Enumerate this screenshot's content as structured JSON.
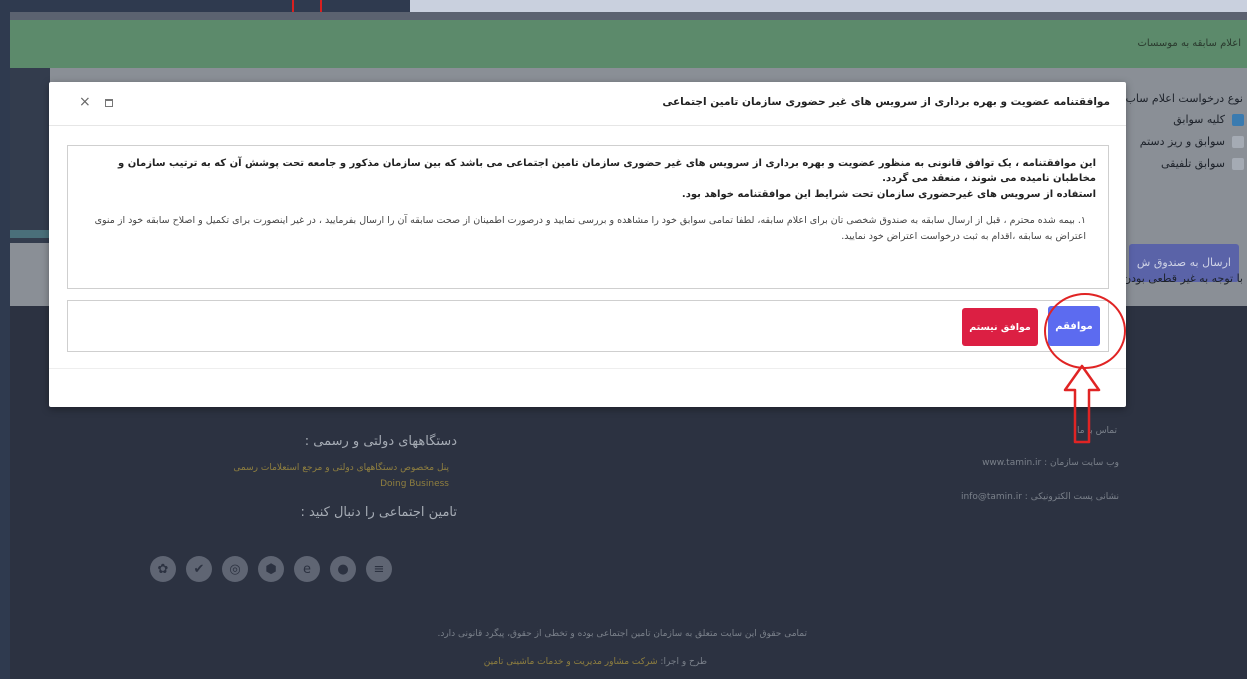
{
  "colors": {
    "frame_dark": "#2f3a4f",
    "green_bar": "#5c8a6b",
    "agree_button": "#5c6bf0",
    "disagree_button": "#dc1f43",
    "annotation_red": "#e02424"
  },
  "background_page": {
    "green_bar_text": "اعلام سابقه به موسسات",
    "request_type_label": "نوع درخواست اعلام ساب",
    "options": [
      "کلیه سوابق",
      "سوابق و ریز دستم",
      "سوابق تلفیقی"
    ],
    "send_button": "ارسال به صندوق ش",
    "notice_text": "با توجه به غیر قطعی بودن"
  },
  "footer": {
    "gov_heading": "دستگاههای دولتی و رسمی :",
    "gov_link_1": "پنل مخصوص دستگاههای دولتی و مرجع استعلامات رسمی",
    "gov_link_2": "Doing Business",
    "follow_heading": "تامین اجتماعی را دنبال کنید :",
    "contact_heading": "تماس با ما",
    "website": "وب سایت سازمان : www.tamin.ir",
    "email": "نشانی پست الکترونیکی : info@tamin.ir",
    "copyright": "تمامی حقوق این سایت متعلق به سازمان تامین اجتماعی بوده و تخطی از حقوق، پیگرد قانونی دارد.",
    "designer_prefix": "طرح و اجرا:",
    "designer_name": "شرکت مشاور مدیریت و خدمات ماشینی تامین"
  },
  "modal": {
    "title": "موافقتنامه عضویت و بهره برداری از سرویس های غیر حضوری سازمان تامین اجتماعی",
    "paragraph": "این موافقتنامه ، یک توافق قانونی به منظور عضویت و بهره برداری از سرویس های غیر حضوری سازمان تامین اجتماعی می باشد که بین سازمان مذکور و جامعه تحت پوشش آن که به ترتیب سازمان و مخاطبان نامیده می شوند ، منعقد می گردد.",
    "usage_line": "استفاده از سرویس های غیرحضوری سازمان تحت شرایط این موافقتنامه خواهد بود.",
    "item_1": "۱. بیمه شده محترم ، قبل از ارسال سابقه به صندوق شخصی تان برای اعلام سابقه، لطفا تمامی سوابق خود را مشاهده و بررسی نمایید و درصورت اطمینان از صحت سابقه آن را ارسال بفرمایید ، در غیر اینصورت برای تکمیل و اصلاح سابقه خود از منوی اعتراض به سابقه ،اقدام به ثبت درخواست اعتراض خود نمایید.",
    "agree_label": "موافقم",
    "disagree_label": "موافق نیستم"
  }
}
